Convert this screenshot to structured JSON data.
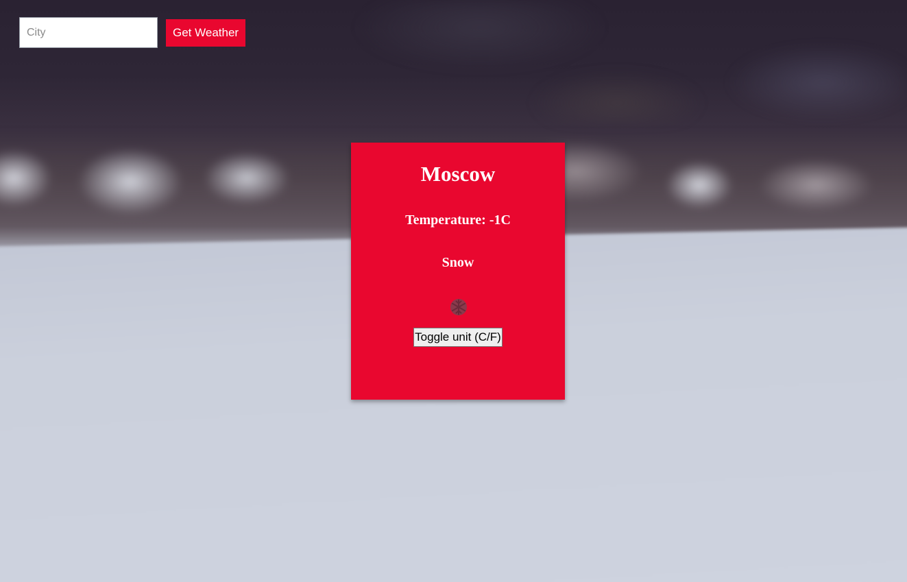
{
  "search": {
    "placeholder": "City",
    "value": "",
    "button_label": "Get Weather"
  },
  "weather": {
    "city": "Moscow",
    "temperature_text": "Temperature: -1C",
    "condition": "Snow",
    "icon": "snowflake-icon",
    "toggle_label": "Toggle unit (C/F)"
  },
  "colors": {
    "accent": "#e9072f",
    "card_text": "#ffffff"
  }
}
